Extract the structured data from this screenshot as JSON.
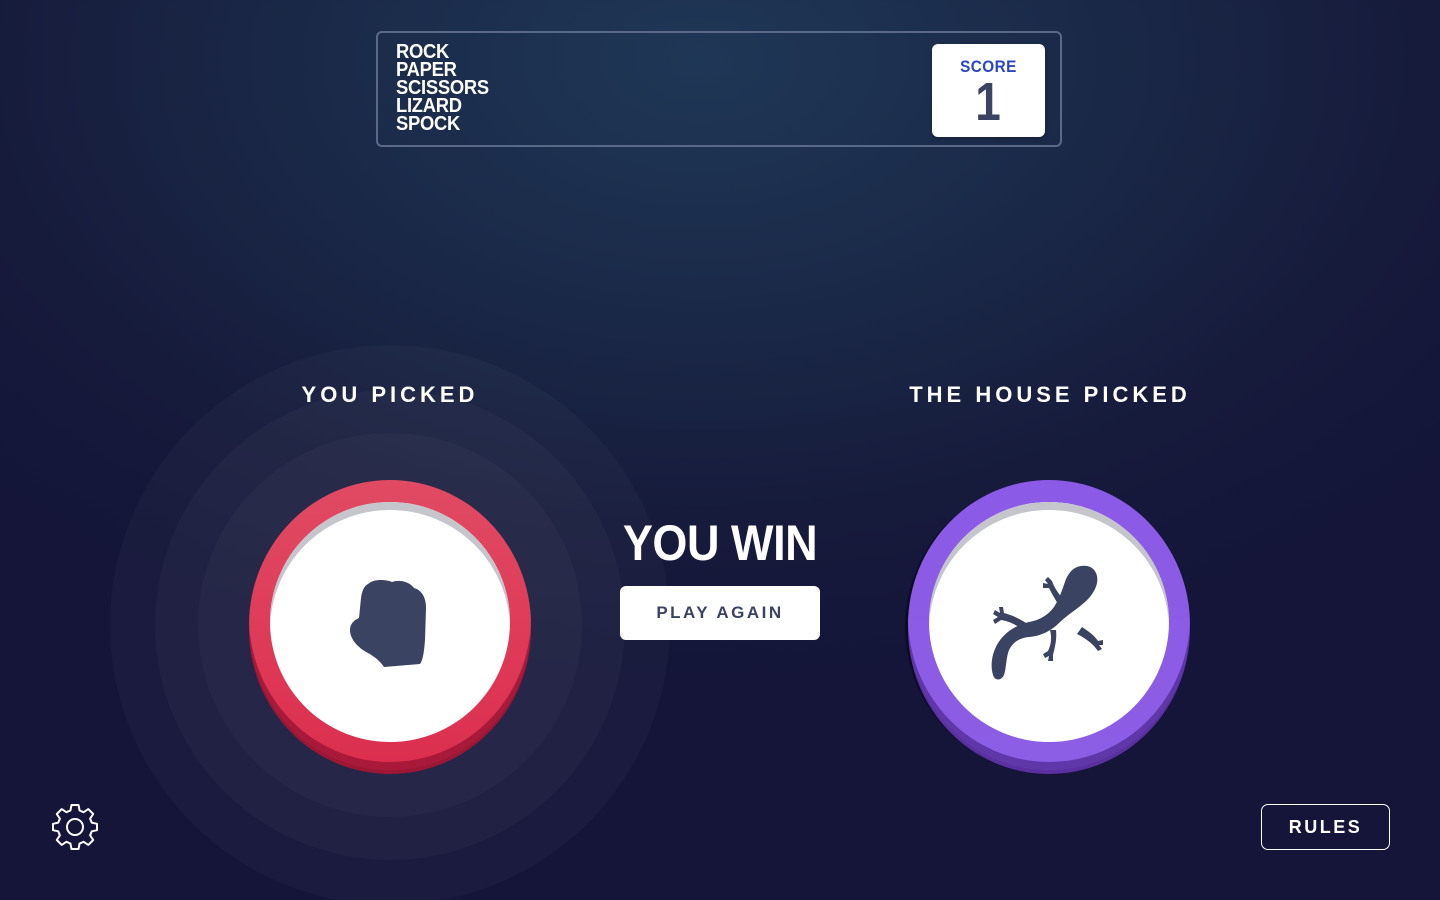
{
  "header": {
    "logo_lines": [
      "ROCK",
      "PAPER",
      "SCISSORS",
      "LIZARD",
      "SPOCK"
    ],
    "score_label": "SCORE",
    "score_value": "1"
  },
  "game": {
    "player_label": "YOU PICKED",
    "house_label": "THE HOUSE PICKED",
    "player_pick": "rock",
    "house_pick": "lizard",
    "result_text": "YOU WIN",
    "play_again_label": "PLAY AGAIN"
  },
  "footer": {
    "settings_icon": "gear-icon",
    "rules_label": "RULES"
  },
  "colors": {
    "rock": "#dc2e4e",
    "lizard": "#8c5de5",
    "icon": "#3b4363",
    "score_label": "#2a46c0"
  }
}
